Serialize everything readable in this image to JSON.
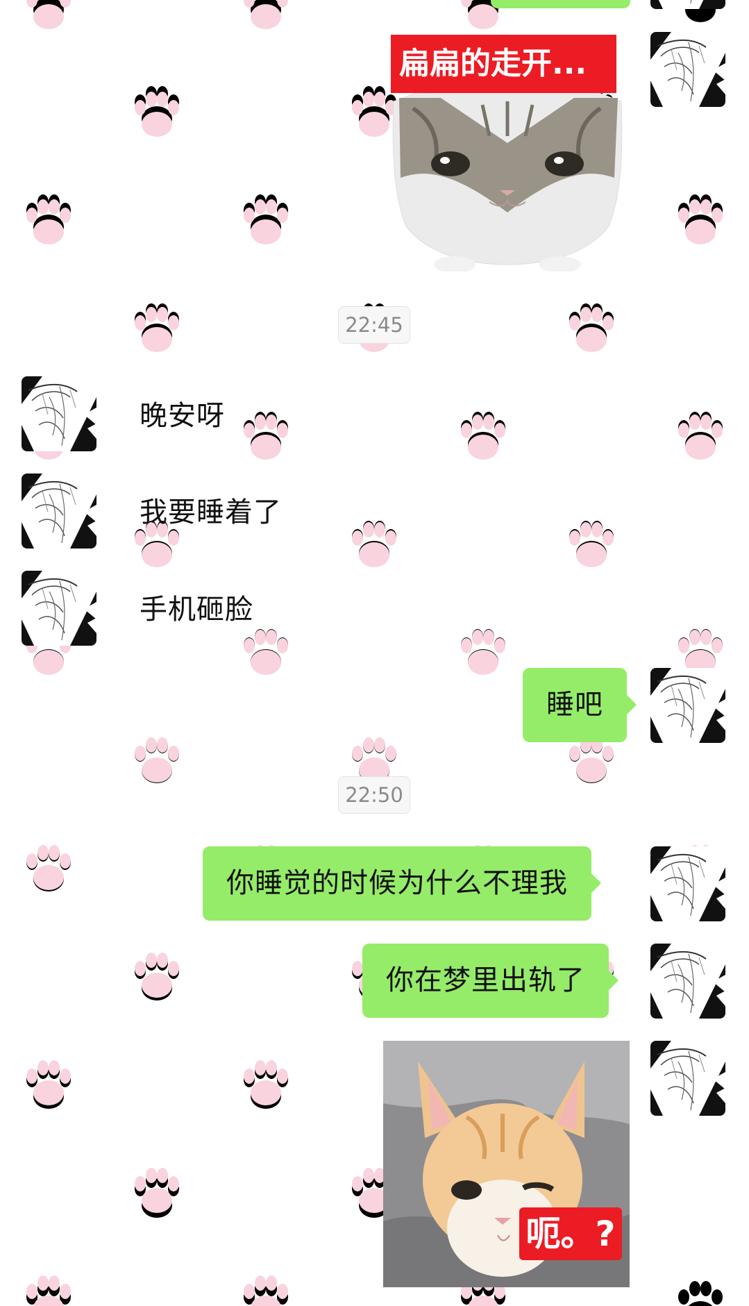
{
  "timestamps": [
    "22:45",
    "22:50"
  ],
  "stickers": {
    "flat_cat_caption": "扁扁的走开...",
    "kitten_caption": "呃。?"
  },
  "messages": {
    "theirs_1": "晚安呀",
    "theirs_2": "我要睡着了",
    "theirs_3": "手机砸脸",
    "mine_1": "睡吧",
    "mine_2": "你睡觉的时候为什么不理我",
    "mine_3": "你在梦里出轨了"
  },
  "colors": {
    "my_bubble": "#95ec69",
    "paw_print": "#f9d3dd",
    "sticker_caption_bg": "#ec1c24"
  },
  "icons": {
    "avatar": "manga-girl-avatar",
    "background": "paw-print-pattern"
  }
}
